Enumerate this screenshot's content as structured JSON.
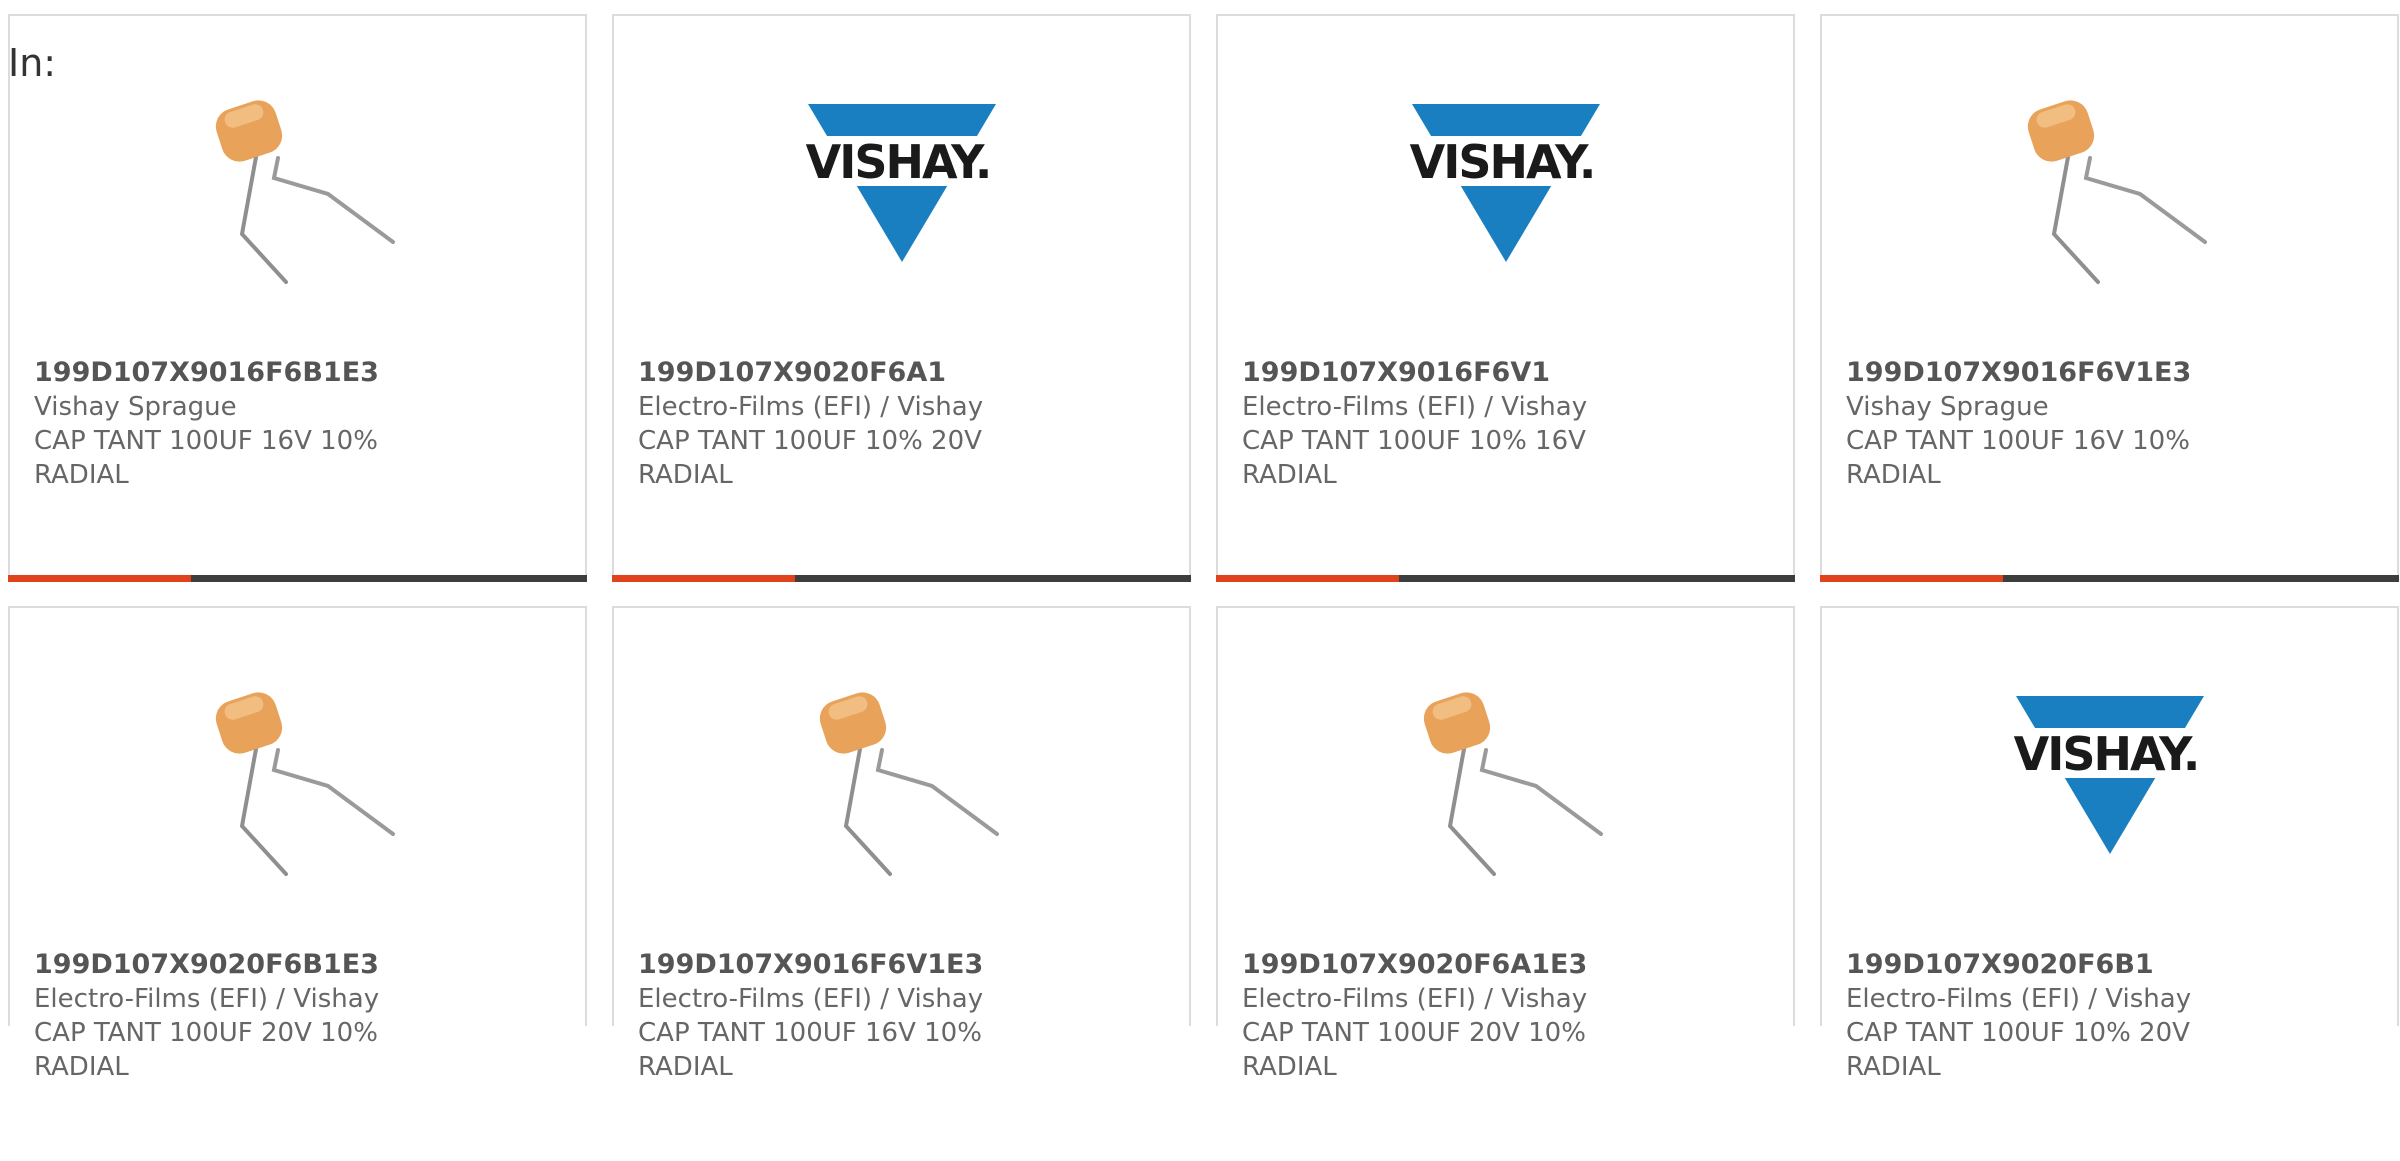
{
  "header": {
    "in_label": "In:"
  },
  "colors": {
    "accent": "#e0421c",
    "bar": "#3d3d3d",
    "vishay_blue": "#1a7fc1",
    "capacitor_orange": "#e8a25a"
  },
  "products": [
    {
      "part_number": "199D107X9016F6B1E3",
      "manufacturer": "Vishay Sprague",
      "description_line1": "CAP TANT 100UF 16V 10%",
      "description_line2": "RADIAL",
      "image": "capacitor-icon"
    },
    {
      "part_number": "199D107X9020F6A1",
      "manufacturer": "Electro-Films (EFI) / Vishay",
      "description_line1": "CAP TANT 100UF 10% 20V",
      "description_line2": "RADIAL",
      "image": "vishay-logo-icon",
      "logo_text": "VISHAY."
    },
    {
      "part_number": "199D107X9016F6V1",
      "manufacturer": "Electro-Films (EFI) / Vishay",
      "description_line1": "CAP TANT 100UF 10% 16V",
      "description_line2": "RADIAL",
      "image": "vishay-logo-icon",
      "logo_text": "VISHAY."
    },
    {
      "part_number": "199D107X9016F6V1E3",
      "manufacturer": "Vishay Sprague",
      "description_line1": "CAP TANT 100UF 16V 10%",
      "description_line2": "RADIAL",
      "image": "capacitor-icon"
    },
    {
      "part_number": "199D107X9020F6B1E3",
      "manufacturer": "Electro-Films (EFI) / Vishay",
      "description_line1": "CAP TANT 100UF 20V 10%",
      "description_line2": "RADIAL",
      "image": "capacitor-icon"
    },
    {
      "part_number": "199D107X9016F6V1E3",
      "manufacturer": "Electro-Films (EFI) / Vishay",
      "description_line1": "CAP TANT 100UF 16V 10%",
      "description_line2": "RADIAL",
      "image": "capacitor-icon"
    },
    {
      "part_number": "199D107X9020F6A1E3",
      "manufacturer": "Electro-Films (EFI) / Vishay",
      "description_line1": "CAP TANT 100UF 20V 10%",
      "description_line2": "RADIAL",
      "image": "capacitor-icon"
    },
    {
      "part_number": "199D107X9020F6B1",
      "manufacturer": "Electro-Films (EFI) / Vishay",
      "description_line1": "CAP TANT 100UF 10% 20V",
      "description_line2": "RADIAL",
      "image": "vishay-logo-icon",
      "logo_text": "VISHAY."
    }
  ]
}
